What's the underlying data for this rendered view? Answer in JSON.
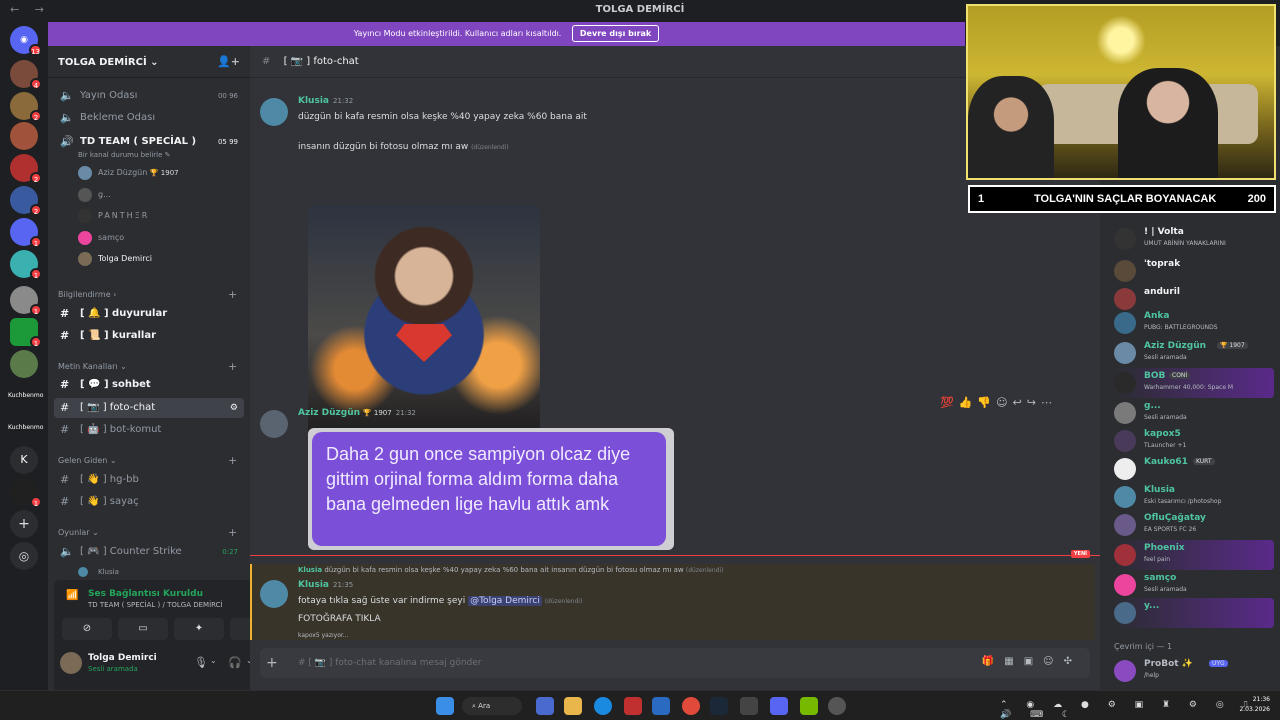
{
  "window": {
    "title": "TOLGA DEMİRCİ",
    "nav": "← →"
  },
  "banner": {
    "text": "Yayıncı Modu etkinleştirildi. Kullanıcı adları kısaltıldı.",
    "button": "Devre dışı bırak"
  },
  "servers": {
    "badges": [
      "13",
      "4",
      "2",
      "2",
      "2",
      "1",
      "1",
      "1",
      "1",
      "1",
      "1"
    ],
    "text_items": [
      "Kuchbenmo",
      "Kuchbenmo"
    ],
    "letter": "K"
  },
  "guild": {
    "name": "TOLGA DEMİRCİ ⌄"
  },
  "voice_channels": [
    {
      "name": "Yayın Odası",
      "count": "00 96"
    },
    {
      "name": "Bekleme Odası"
    },
    {
      "name": "TD TEAM ( SPECİAL )",
      "count": "05 99",
      "status": "Bir kanal durumu belirle ✎"
    }
  ],
  "voice_members": [
    "Aziz Düzgün",
    "g...",
    "PANTHΞR",
    "samço",
    "Tolga Demirci"
  ],
  "voice_member_badge": "🏆 1907",
  "categories": {
    "info": "Bilgilendirme ›",
    "text": "Metin Kanalları ⌄",
    "incoming": "Gelen Giden ⌄",
    "games": "Oyunlar ⌄"
  },
  "text_channels": {
    "duyurular": "duyurular",
    "kurallar": "kurallar",
    "sohbet": "sohbet",
    "foto": "foto-chat",
    "bot": "bot-komut",
    "hgbb": "hg-bb",
    "sayac": "sayaç",
    "cs": "Counter Strike",
    "cs_time": "0:27",
    "cs_member": "Klusia"
  },
  "voice_status": {
    "title": "Ses Bağlantısı Kuruldu",
    "sub": "TD TEAM ( SPECİAL ) / TOLGA DEMİRCİ"
  },
  "user": {
    "name": "Tolga Demirci",
    "status": "Sesli aramada"
  },
  "channel": {
    "name": "[ 📷 ]  foto-chat"
  },
  "messages": {
    "m1_author": "Klusia",
    "m1_time": "21:32",
    "m1_line1": "düzgün bi kafa resmin olsa keşke %40 yapay zeka %60 bana ait",
    "m1_line2": "insanın düzgün bi fotosu olmaz mı aw",
    "edited": "(düzenlendi)",
    "m2_author": "Aziz Düzgün",
    "m2_badge": "🏆 1907",
    "m2_time": "21:32",
    "m2_image_text": "Daha 2 gun once sampiyon olcaz diye gittim orjinal forma aldım forma daha bana gelmeden lige havlu attık amk",
    "new_label": "YENİ",
    "reply_author": "Klusia",
    "reply_text": "düzgün bi kafa resmin olsa keşke %40 yapay zeka %60 bana ait  insanın düzgün bi fotosu olmaz mı aw",
    "m3_author": "Klusia",
    "m3_time": "21:35",
    "m3_line1": "fotaya tıkla sağ üste var indirme şeyi",
    "m3_mention": "@Tolga Demirci",
    "m3_line2": "FOTOĞRAFA TIKLA",
    "typing": "kapox5 yazıyor..."
  },
  "input": {
    "placeholder": "#  [ 📷 ]  foto-chat kanalına mesaj gönder"
  },
  "stream_overlay": {
    "goal_num": "1",
    "goal_text": "TOLGA'NIN SAÇLAR BOYANACAK",
    "goal_target": "200"
  },
  "member_list": [
    {
      "name": "! | Volta",
      "status": "UMUT ABİNİN YANAKLARINI",
      "color": "#f2f3f5"
    },
    {
      "name": "'toprak",
      "status": "",
      "color": "#f2f3f5"
    },
    {
      "name": "anduril",
      "status": "",
      "color": "#f2f3f5"
    },
    {
      "name": "Anka",
      "status": "PUBG: BATTLEGROUNDS",
      "color": "#4fc4a0"
    },
    {
      "name": "Aziz Düzgün",
      "tag": "🏆 1907",
      "status": "Sesli aramada",
      "color": "#4fc4a0"
    },
    {
      "name": "BOB",
      "tag": "CONİ",
      "status": "Warhammer 40,000: Space M",
      "color": "#4fc4a0"
    },
    {
      "name": "g...",
      "status": "Sesli aramada",
      "color": "#4fc4a0"
    },
    {
      "name": "kapox5",
      "status": "TLauncher +1",
      "color": "#4fc4a0"
    },
    {
      "name": "Kauko61",
      "tag": "KURT",
      "status": "",
      "color": "#4fc4a0"
    },
    {
      "name": "Klusia",
      "status": "Eski tasarımcı /photoshop",
      "color": "#4fc4a0"
    },
    {
      "name": "OfluÇağatay",
      "status": "EA SPORTS FC 26",
      "color": "#4fc4a0"
    },
    {
      "name": "Phoenix",
      "status": "feel pain",
      "color": "#4fc4a0"
    },
    {
      "name": "samço",
      "status": "Sesli aramada",
      "color": "#4fc4a0"
    },
    {
      "name": "y...",
      "status": "",
      "color": "#4fc4a0"
    }
  ],
  "online_header": "Çevrim içi — 1",
  "probot": {
    "name": "ProBot ✨",
    "tag": "UYG",
    "status": "/help"
  },
  "taskbar": {
    "search": "Ara",
    "time": "21:36",
    "date": "2.03.2026"
  }
}
